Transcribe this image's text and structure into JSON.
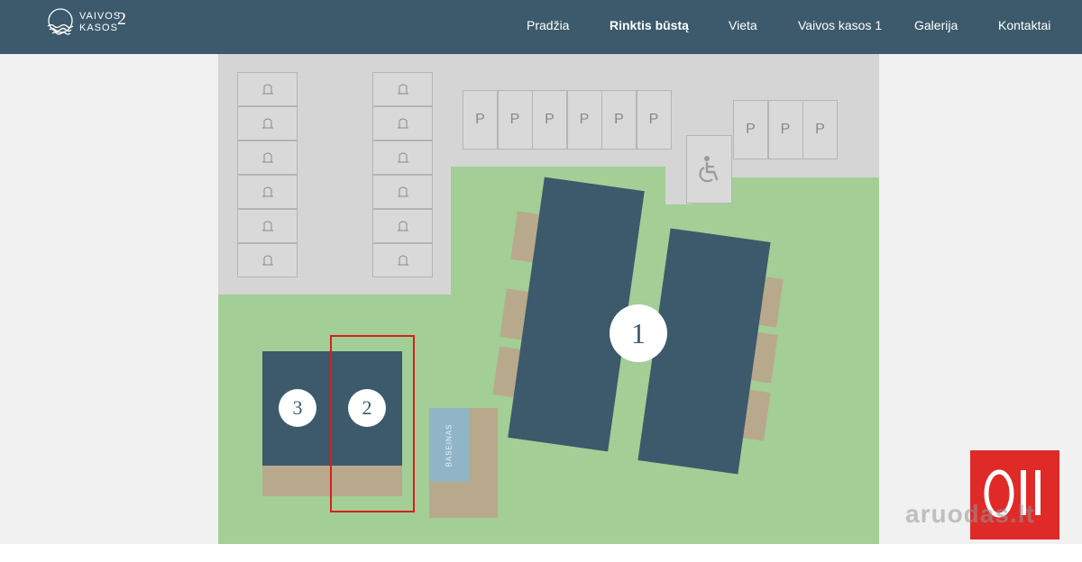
{
  "header": {
    "logo": {
      "line1": "VAIVOS",
      "line2": "KASOS",
      "number": "2"
    },
    "nav": [
      {
        "label": "Pradžia",
        "active": false
      },
      {
        "label": "Rinktis būstą",
        "active": true
      },
      {
        "label": "Vieta",
        "active": false
      },
      {
        "label": "Vaivos kasos 1",
        "active": false
      },
      {
        "label": "Galerija",
        "active": false
      },
      {
        "label": "Kontaktai",
        "active": false
      }
    ]
  },
  "siteplan": {
    "parking_label": "P",
    "accessible_icon": "wheelchair-icon",
    "storage_icon": "storage-lot-icon",
    "buildings": [
      {
        "number": "1"
      },
      {
        "number": "2"
      },
      {
        "number": "3"
      }
    ],
    "pool_label": "BASEINAS",
    "selected_building": "2"
  },
  "watermark": {
    "text": "aruodas.lt",
    "badge_icon": "aruodas-logo-icon"
  },
  "colors": {
    "header_bg": "#3c5a6b",
    "building": "#3c5a6b",
    "lawn": "#a3ce95",
    "paving": "#d5d5d5",
    "terrace": "#b8a98d",
    "pool": "#8fb5c7",
    "selection": "#d7201f",
    "badge": "#e02a28"
  }
}
